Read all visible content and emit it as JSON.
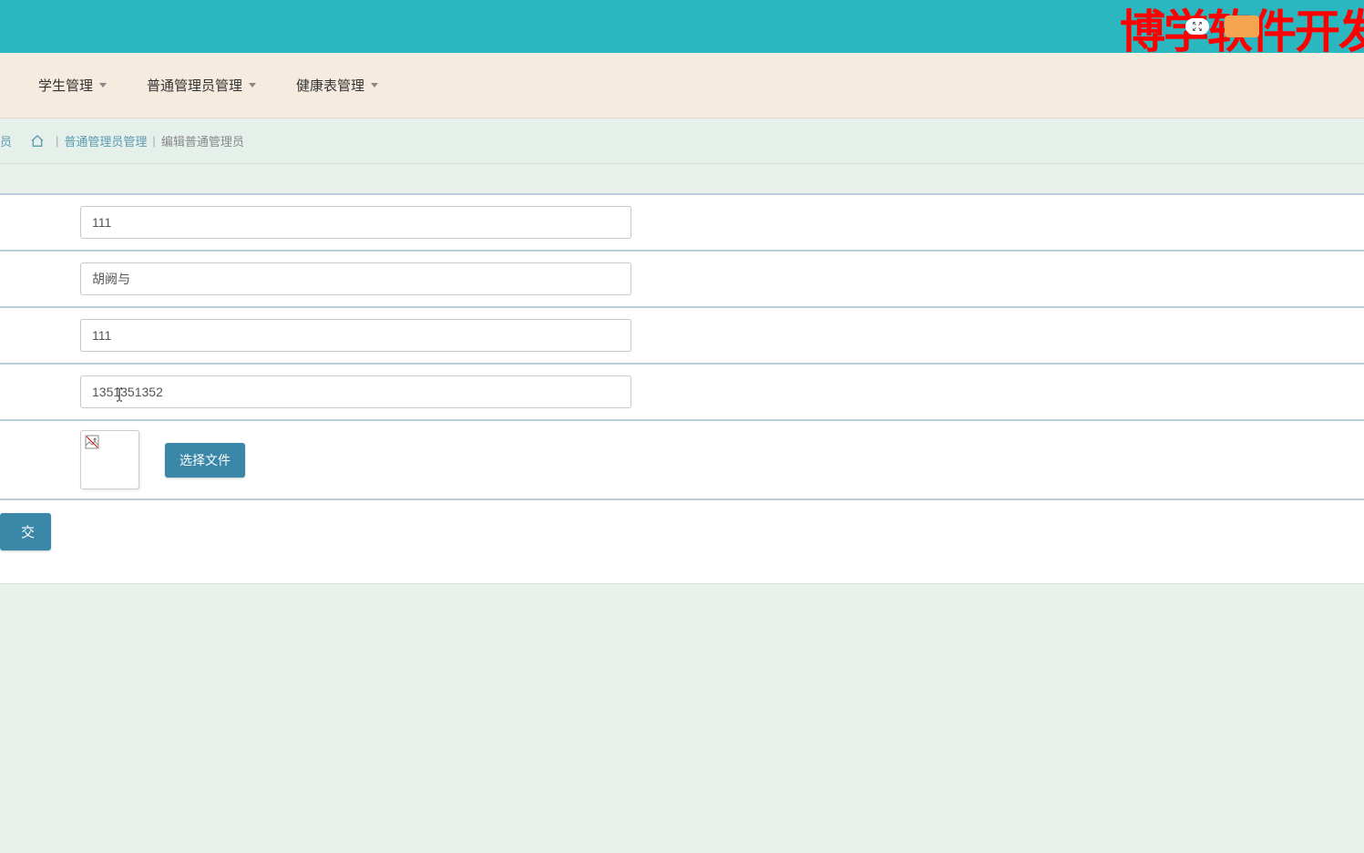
{
  "brand": "博学软件开发",
  "nav": {
    "items": [
      {
        "label": "学生管理"
      },
      {
        "label": "普通管理员管理"
      },
      {
        "label": "健康表管理"
      }
    ]
  },
  "breadcrumb": {
    "truncated_first": "员",
    "parts": [
      {
        "label": "普通管理员管理",
        "link": true
      },
      {
        "label": "编辑普通管理员",
        "link": false
      }
    ]
  },
  "form": {
    "field1": {
      "value": "111"
    },
    "field2": {
      "value": "胡阙与"
    },
    "field3": {
      "value": "111"
    },
    "field4": {
      "value": "1351351352"
    },
    "file_button": "选择文件",
    "submit": "交"
  },
  "colors": {
    "banner": "#2bb7c0",
    "brand_text": "#ff0000",
    "nav_bg": "#f5ebdf",
    "accent": "#3a87a8",
    "breadcrumb_link": "#5b9bb0"
  }
}
